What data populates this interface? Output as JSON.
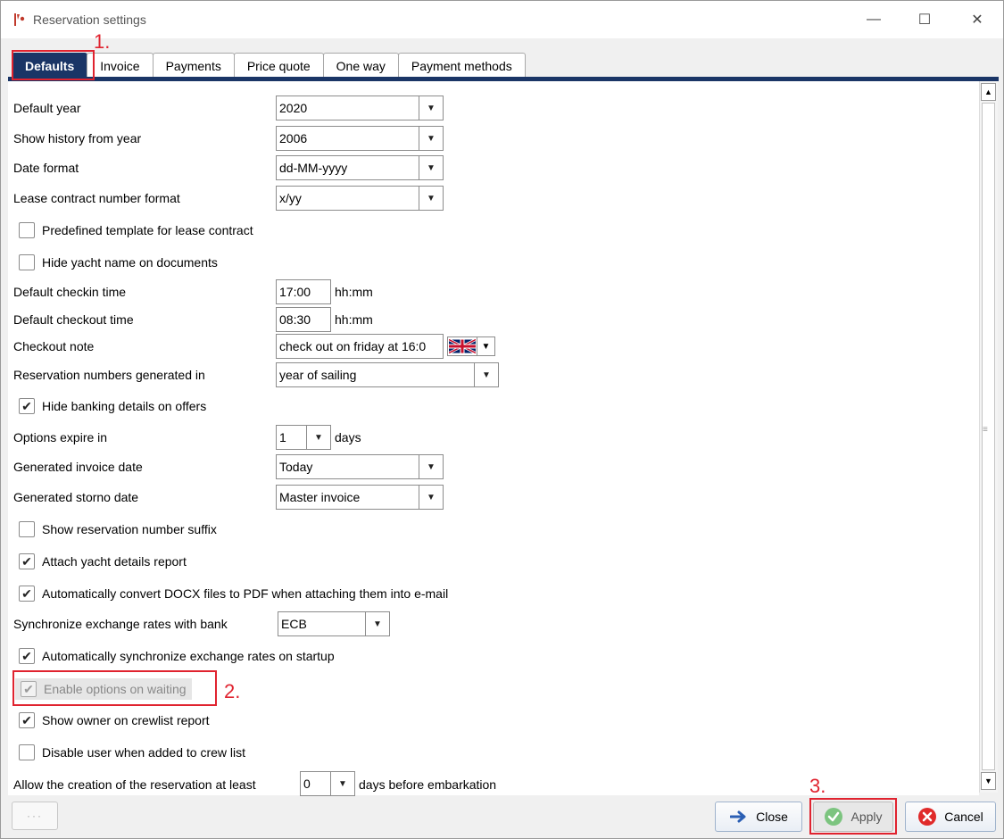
{
  "window": {
    "title": "Reservation settings",
    "minimize_glyph": "—",
    "maximize_glyph": "☐",
    "close_glyph": "✕"
  },
  "tabs": [
    {
      "label": "Defaults",
      "active": true
    },
    {
      "label": "Invoice",
      "active": false
    },
    {
      "label": "Payments",
      "active": false
    },
    {
      "label": "Price quote",
      "active": false
    },
    {
      "label": "One way",
      "active": false
    },
    {
      "label": "Payment methods",
      "active": false
    }
  ],
  "form": {
    "default_year": {
      "label": "Default year",
      "value": "2020"
    },
    "history_year": {
      "label": "Show history from year",
      "value": "2006"
    },
    "date_format": {
      "label": "Date format",
      "value": "dd-MM-yyyy"
    },
    "lease_format": {
      "label": "Lease contract number format",
      "value": "x/yy"
    },
    "predefined_template": {
      "label": "Predefined template for lease contract",
      "checked": false
    },
    "hide_yacht_name": {
      "label": "Hide yacht name on documents",
      "checked": false
    },
    "checkin_time": {
      "label": "Default checkin time",
      "value": "17:00",
      "unit": "hh:mm"
    },
    "checkout_time": {
      "label": "Default checkout time",
      "value": "08:30",
      "unit": "hh:mm"
    },
    "checkout_note": {
      "label": "Checkout note",
      "value": "check out on friday at 16:0"
    },
    "reservation_numbers": {
      "label": "Reservation numbers generated in",
      "value": "year of sailing"
    },
    "hide_banking": {
      "label": "Hide banking details on offers",
      "checked": true
    },
    "options_expire": {
      "label": "Options expire in",
      "value": "1",
      "unit": "days"
    },
    "invoice_date": {
      "label": "Generated invoice date",
      "value": "Today"
    },
    "storno_date": {
      "label": "Generated storno date",
      "value": "Master invoice"
    },
    "show_suffix": {
      "label": "Show reservation number suffix",
      "checked": false
    },
    "attach_yacht_report": {
      "label": "Attach yacht details report",
      "checked": true
    },
    "convert_docx": {
      "label": "Automatically convert DOCX files to PDF when attaching them into e-mail",
      "checked": true
    },
    "sync_bank": {
      "label": "Synchronize exchange rates with bank",
      "value": "ECB"
    },
    "auto_sync": {
      "label": "Automatically synchronize exchange rates on startup",
      "checked": true
    },
    "enable_waiting": {
      "label": "Enable options on waiting",
      "checked": true,
      "disabled": true
    },
    "show_owner": {
      "label": "Show owner on crewlist report",
      "checked": true
    },
    "disable_user": {
      "label": "Disable user when added to crew list",
      "checked": false
    },
    "min_days": {
      "label_before": "Allow the creation of the reservation at least",
      "value": "0",
      "label_after": "days before embarkation"
    }
  },
  "annotations": {
    "step1": "1.",
    "step2": "2.",
    "step3": "3."
  },
  "buttons": {
    "more": "···",
    "close": "Close",
    "apply": "Apply",
    "cancel": "Cancel"
  },
  "glyphs": {
    "check": "✔",
    "dropdown": "▼",
    "scroll_up": "▲",
    "scroll_down": "▼",
    "scroll_grip": "≡"
  },
  "colors": {
    "tab_active": "#1a3566",
    "annotation_red": "#e0232f",
    "apply_green": "#5cb85c",
    "cancel_red": "#e02a2a",
    "close_blue": "#2b5fb4"
  }
}
